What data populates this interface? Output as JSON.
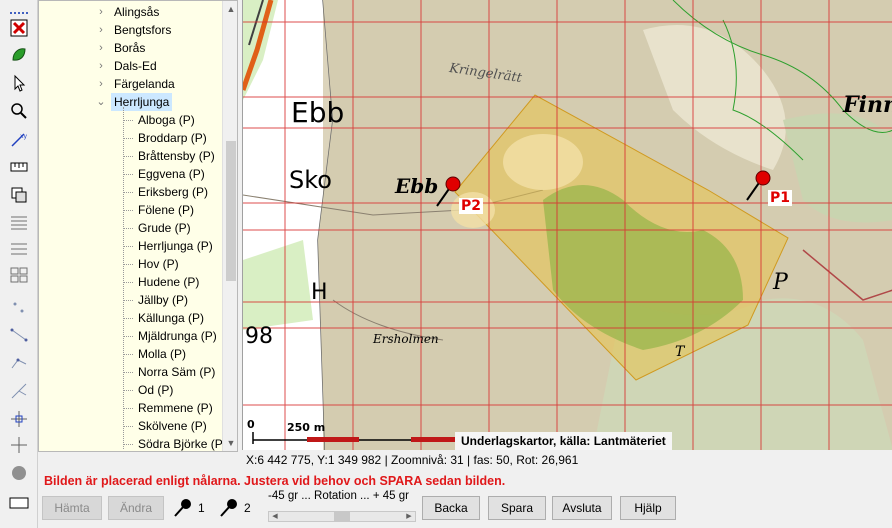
{
  "tree": {
    "parents": [
      {
        "label": "Alingsås",
        "expanded": false
      },
      {
        "label": "Bengtsfors",
        "expanded": false
      },
      {
        "label": "Borås",
        "expanded": false
      },
      {
        "label": "Dals-Ed",
        "expanded": false
      },
      {
        "label": "Färgelanda",
        "expanded": false
      },
      {
        "label": "Herrljunga",
        "expanded": true,
        "selected": true
      }
    ],
    "children": [
      "Alboga (P)",
      "Broddarp (P)",
      "Bråttensby (P)",
      "Eggvena (P)",
      "Eriksberg (P)",
      "Fölene (P)",
      "Grude (P)",
      "Herrljunga (P)",
      "Hov (P)",
      "Hudene (P)",
      "Jällby (P)",
      "Källunga (P)",
      "Mjäldrunga (P)",
      "Molla (P)",
      "Norra Säm (P)",
      "Od (P)",
      "Remmene (P)",
      "Skölvene (P)",
      "Södra Björke (P)"
    ]
  },
  "map": {
    "labels": {
      "ebb": "Ebb",
      "sko": "Sko",
      "ebb_italic": "Ebb",
      "kringelratt": "Kringelrätt",
      "finn": "Finn",
      "ersholmen": "Ersholmen",
      "num98": "98",
      "letter_p": "P",
      "letter_h": "H",
      "letter_t": "T"
    },
    "pins": [
      {
        "id": "P1",
        "label": "P1"
      },
      {
        "id": "P2",
        "label": "P2"
      }
    ],
    "scalebar": {
      "zero": "0",
      "distance": "250 m"
    },
    "caption": "Underlagskartor, källa: Lantmäteriet",
    "colors": {
      "overlay": "#e8c24a",
      "grid": "#d83030",
      "pin": "#e00000"
    }
  },
  "status": {
    "text": "X:6 442 775, Y:1 349 982  |  Zoomnivå: 31  |  fas: 50, Rot: 26,961"
  },
  "message": "Bilden är placerad enligt nålarna. Justera vid behov och SPARA sedan bilden.",
  "controls": {
    "fetch_label": "Hämta",
    "change_label": "Ändra",
    "pin1_label": "1",
    "pin2_label": "2",
    "rotation_label": "-45 gr   ... Rotation ... + 45 gr",
    "rotation_value_fraction": 0.5,
    "back_label": "Backa",
    "save_label": "Spara",
    "exit_label": "Avsluta",
    "help_label": "Hjälp"
  },
  "toolbar_icons": [
    "dotted-line-icon",
    "close-layer-icon",
    "leaf-icon",
    "pointer-icon",
    "magnifier-icon",
    "coordinate-pick-icon",
    "ruler-icon",
    "copy-layers-icon",
    "grid-dense-icon",
    "grid-medium-icon",
    "grid-split-icon",
    "small-dots-icon",
    "line-dots-icon",
    "node-dots-icon",
    "branch-icon",
    "move-crosshair-icon",
    "circle-icon",
    "rectangle-icon"
  ]
}
